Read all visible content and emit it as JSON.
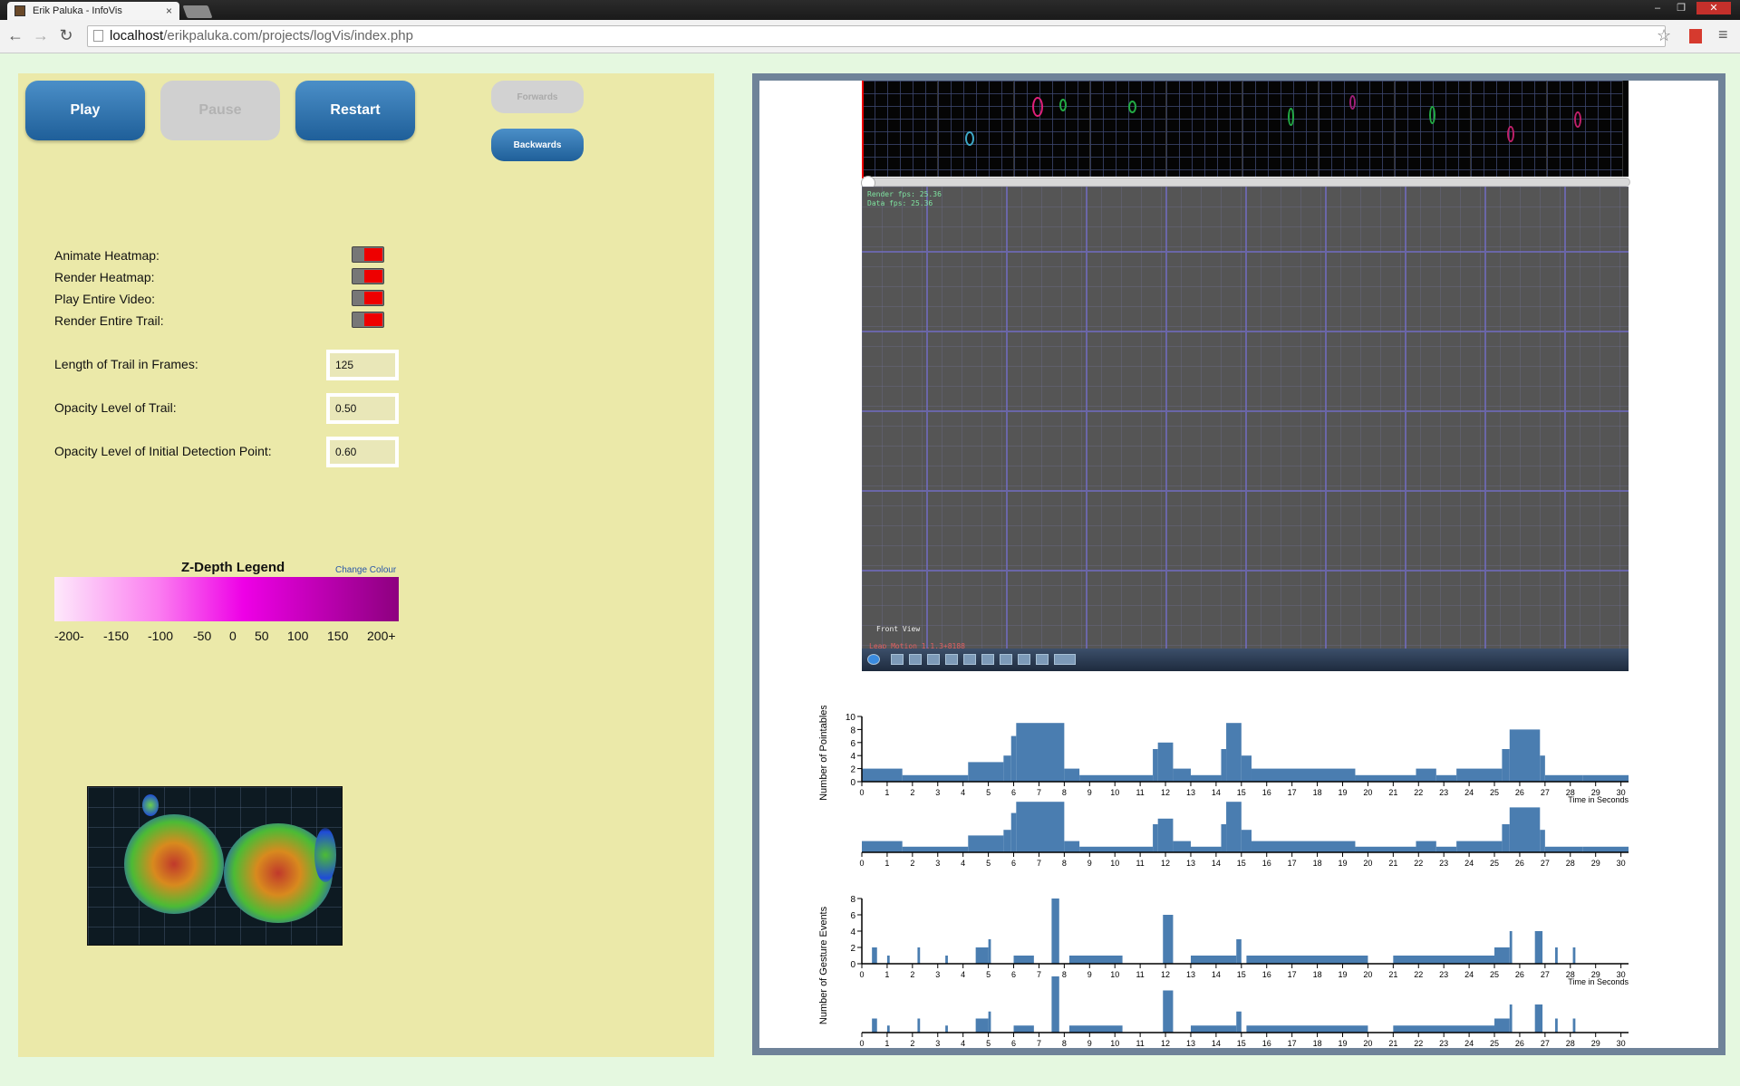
{
  "browser": {
    "tab_title": "Erik Paluka - InfoVis",
    "tab_close": "×",
    "url_host": "localhost",
    "url_path": "/erikpaluka.com/projects/logVis/index.php",
    "back_glyph": "←",
    "forward_glyph": "→",
    "reload_glyph": "↻",
    "star_glyph": "☆",
    "menu_glyph": "≡",
    "min_glyph": "–",
    "max_glyph": "❐",
    "close_glyph": "✕"
  },
  "controls": {
    "play_label": "Play",
    "pause_label": "Pause",
    "restart_label": "Restart",
    "forwards_label": "Forwards",
    "backwards_label": "Backwards"
  },
  "options": [
    {
      "label": "Animate Heatmap:",
      "on": true
    },
    {
      "label": "Render Heatmap:",
      "on": true
    },
    {
      "label": "Play Entire Video:",
      "on": true
    },
    {
      "label": "Render Entire Trail:",
      "on": true
    }
  ],
  "fields": [
    {
      "label": "Length of Trail in Frames:",
      "value": "125"
    },
    {
      "label": "Opacity Level of Trail:",
      "value": "0.50"
    },
    {
      "label": "Opacity Level of Initial Detection Point:",
      "value": "0.60"
    }
  ],
  "legend": {
    "title": "Z-Depth Legend",
    "change_colour": "Change Colour",
    "ticks": [
      "-200-",
      "-150",
      "-100",
      "-50",
      "0",
      "50",
      "100",
      "150",
      "200+"
    ],
    "gradient_colors": [
      "#fde9fb",
      "#fb7ef0",
      "#ee00e6",
      "#8d007f"
    ]
  },
  "video": {
    "render_fps": "Render fps: 25.36",
    "data_fps": "Data fps: 25.36",
    "view_label": "Front View",
    "version": "Leap Motion 1.1.3+8188"
  },
  "colors": {
    "bar_blue": "#4a7db0",
    "toggle_red": "#ee0000",
    "panel_yellow": "#ebe9a9",
    "page_green": "#e5f8e0",
    "frame_border": "#6f8399"
  },
  "chart_data": [
    {
      "type": "bar",
      "ylabel": "Number of Pointables",
      "xlabel": "Time in Seconds",
      "yticks": [
        "0",
        "2",
        "4",
        "6",
        "8",
        "10"
      ],
      "ylim": [
        0,
        10
      ],
      "xlim": [
        0,
        30.3
      ],
      "xticks": [
        "0",
        "1",
        "2",
        "3",
        "4",
        "5",
        "6",
        "7",
        "8",
        "9",
        "10",
        "11",
        "12",
        "13",
        "14",
        "15",
        "16",
        "17",
        "18",
        "19",
        "20",
        "21",
        "22",
        "23",
        "24",
        "25",
        "26",
        "27",
        "28",
        "29",
        "30"
      ],
      "segments": [
        {
          "x0": 0.0,
          "x1": 1.6,
          "y": 2
        },
        {
          "x0": 1.6,
          "x1": 4.2,
          "y": 1
        },
        {
          "x0": 4.2,
          "x1": 5.6,
          "y": 3
        },
        {
          "x0": 5.6,
          "x1": 5.9,
          "y": 4
        },
        {
          "x0": 5.9,
          "x1": 6.1,
          "y": 7
        },
        {
          "x0": 6.1,
          "x1": 8.0,
          "y": 9
        },
        {
          "x0": 8.0,
          "x1": 8.6,
          "y": 2
        },
        {
          "x0": 8.6,
          "x1": 11.5,
          "y": 1
        },
        {
          "x0": 11.5,
          "x1": 11.7,
          "y": 5
        },
        {
          "x0": 11.7,
          "x1": 12.3,
          "y": 6
        },
        {
          "x0": 12.3,
          "x1": 13.0,
          "y": 2
        },
        {
          "x0": 13.0,
          "x1": 14.2,
          "y": 1
        },
        {
          "x0": 14.2,
          "x1": 14.4,
          "y": 5
        },
        {
          "x0": 14.4,
          "x1": 15.0,
          "y": 9
        },
        {
          "x0": 15.0,
          "x1": 15.4,
          "y": 4
        },
        {
          "x0": 15.4,
          "x1": 19.5,
          "y": 2
        },
        {
          "x0": 19.5,
          "x1": 21.9,
          "y": 1
        },
        {
          "x0": 21.9,
          "x1": 22.7,
          "y": 2
        },
        {
          "x0": 22.7,
          "x1": 23.5,
          "y": 1
        },
        {
          "x0": 23.5,
          "x1": 25.3,
          "y": 2
        },
        {
          "x0": 25.3,
          "x1": 25.6,
          "y": 5
        },
        {
          "x0": 25.6,
          "x1": 26.8,
          "y": 8
        },
        {
          "x0": 26.8,
          "x1": 27.0,
          "y": 4
        },
        {
          "x0": 27.0,
          "x1": 28.5,
          "y": 1
        },
        {
          "x0": 28.5,
          "x1": 30.3,
          "y": 1
        }
      ]
    },
    {
      "type": "bar",
      "ylabel": "Number of Gesture Events",
      "xlabel": "Time in Seconds",
      "yticks": [
        "0",
        "2",
        "4",
        "6",
        "8"
      ],
      "ylim": [
        0,
        8
      ],
      "xlim": [
        0,
        30.3
      ],
      "xticks": [
        "0",
        "1",
        "2",
        "3",
        "4",
        "5",
        "6",
        "7",
        "8",
        "9",
        "10",
        "11",
        "12",
        "13",
        "14",
        "15",
        "16",
        "17",
        "18",
        "19",
        "20",
        "21",
        "22",
        "23",
        "24",
        "25",
        "26",
        "27",
        "28",
        "29",
        "30"
      ],
      "segments": [
        {
          "x0": 0.4,
          "x1": 0.6,
          "y": 2
        },
        {
          "x0": 1.0,
          "x1": 1.1,
          "y": 1
        },
        {
          "x0": 2.2,
          "x1": 2.3,
          "y": 2
        },
        {
          "x0": 3.3,
          "x1": 3.4,
          "y": 1
        },
        {
          "x0": 4.5,
          "x1": 5.0,
          "y": 2
        },
        {
          "x0": 5.0,
          "x1": 5.1,
          "y": 3
        },
        {
          "x0": 6.0,
          "x1": 6.8,
          "y": 1
        },
        {
          "x0": 7.5,
          "x1": 7.8,
          "y": 8
        },
        {
          "x0": 8.2,
          "x1": 10.3,
          "y": 1
        },
        {
          "x0": 11.9,
          "x1": 12.3,
          "y": 6
        },
        {
          "x0": 13.0,
          "x1": 14.8,
          "y": 1
        },
        {
          "x0": 14.8,
          "x1": 15.0,
          "y": 3
        },
        {
          "x0": 15.2,
          "x1": 20.0,
          "y": 1
        },
        {
          "x0": 21.0,
          "x1": 25.0,
          "y": 1
        },
        {
          "x0": 25.0,
          "x1": 25.6,
          "y": 2
        },
        {
          "x0": 25.6,
          "x1": 25.7,
          "y": 4
        },
        {
          "x0": 26.6,
          "x1": 26.9,
          "y": 4
        },
        {
          "x0": 27.4,
          "x1": 27.5,
          "y": 2
        },
        {
          "x0": 28.1,
          "x1": 28.2,
          "y": 2
        }
      ]
    }
  ]
}
